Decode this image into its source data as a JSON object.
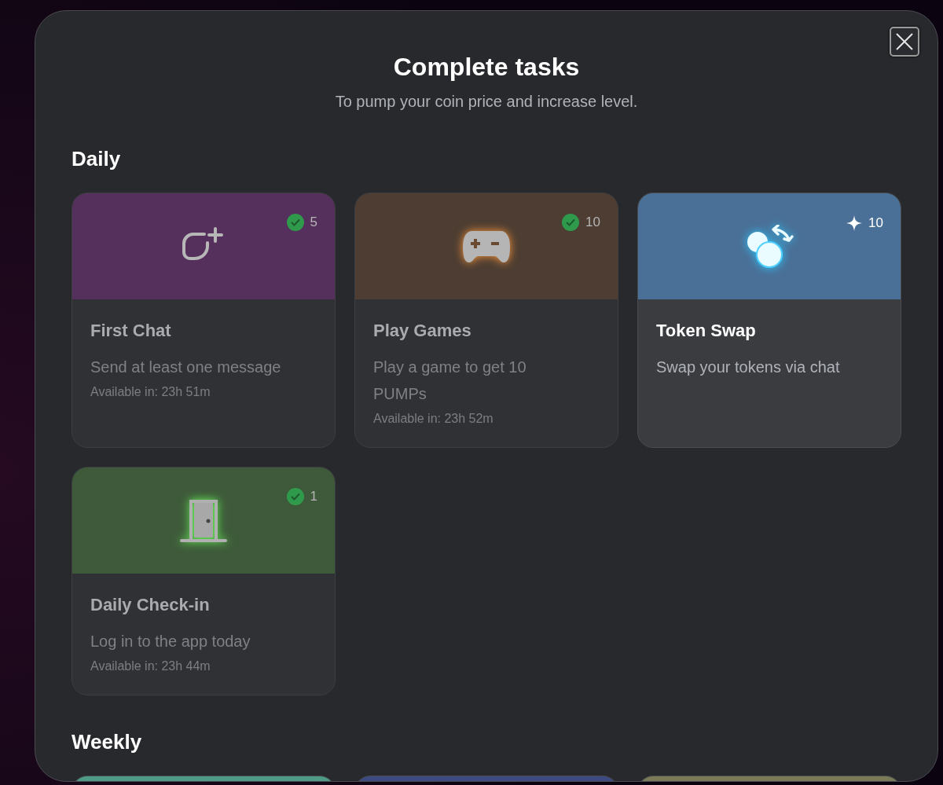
{
  "title": "Complete tasks",
  "subtitle": "To pump your coin price and increase level.",
  "sections": [
    {
      "heading": "Daily",
      "tasks": [
        {
          "kind": "chat",
          "color": "#55305c",
          "completed": true,
          "reward": "5",
          "title": "First Chat",
          "description": "Send at least one message",
          "availability": "Available in: 23h 51m"
        },
        {
          "kind": "gamepad",
          "color": "#4d3d32",
          "completed": true,
          "reward": "10",
          "title": "Play Games",
          "description": "Play a game to get 10 PUMPs",
          "availability": "Available in: 23h 52m"
        },
        {
          "kind": "swap",
          "color": "#4a7097",
          "completed": false,
          "reward": "10",
          "title": "Token Swap",
          "description": "Swap your tokens via chat"
        },
        {
          "kind": "door",
          "color": "#3e5a3a",
          "completed": true,
          "reward": "1",
          "title": "Daily Check-in",
          "description": "Log in to the app today",
          "availability": "Available in: 23h 44m"
        }
      ]
    },
    {
      "heading": "Weekly",
      "tasks": [
        {
          "color": "#4f9a86"
        },
        {
          "color": "#3c4a80"
        },
        {
          "color": "#7a7a58"
        }
      ]
    }
  ]
}
